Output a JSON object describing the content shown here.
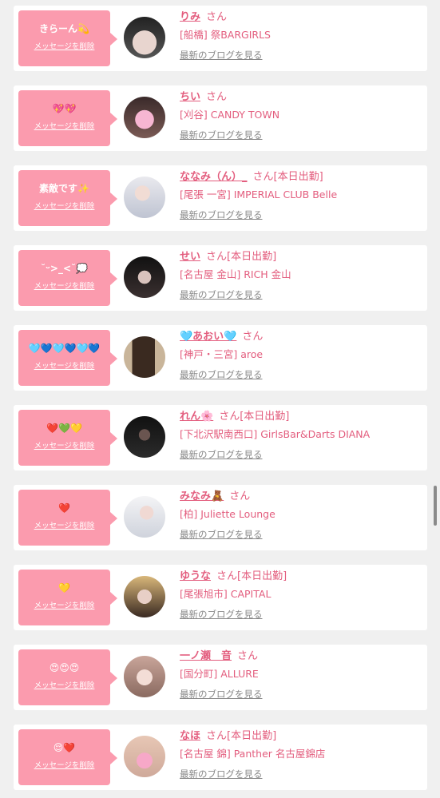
{
  "delete_label": "メッセージを削除",
  "blog_label": "最新のブログを見る",
  "honorific": "さん",
  "colors": {
    "bubble": "#fb9bae",
    "accent": "#e35d7e"
  },
  "entries": [
    {
      "message": "きらーん💫",
      "name": "りみ",
      "status": "",
      "store": "[船橋] 祭BARGIRLS",
      "avatar_icon": "cat-ears-photo"
    },
    {
      "message": "💖💖",
      "name": "ちい",
      "status": "",
      "store": "[刈谷] CANDY TOWN",
      "avatar_icon": "pink-face-photo"
    },
    {
      "message": "素敵です✨",
      "name": "ななみ（ん）_",
      "status": "[本日出勤]",
      "store": "[尾張 一宮] IMPERIAL CLUB Belle",
      "avatar_icon": "white-dress-photo"
    },
    {
      "message": "˘ᵕ>_<˘💭",
      "name": "せい",
      "status": "[本日出勤]",
      "store": "[名古屋 金山] RICH 金山",
      "avatar_icon": "dark-hair-photo"
    },
    {
      "message": "🩵💙🩵💙🩵💙",
      "name": "🩵あおい🩵",
      "status": "",
      "store": "[神戸・三宮] aroe",
      "avatar_icon": "long-hair-back-photo"
    },
    {
      "message": "❤️💚💛",
      "name": "れん🌸",
      "status": "[本日出勤]",
      "store": "[下北沢駅南西口] GirlsBar&Darts DIANA",
      "avatar_icon": "dark-room-photo"
    },
    {
      "message": "❤️",
      "name": "みなみ🧸",
      "status": "",
      "store": "[柏] Juliette Lounge",
      "avatar_icon": "light-outfit-photo"
    },
    {
      "message": "💛",
      "name": "ゆうな",
      "status": "[本日出勤]",
      "store": "[尾張旭市] CAPITAL",
      "avatar_icon": "blonde-hair-photo"
    },
    {
      "message": "😍😍😍",
      "name": "一ノ瀬　音",
      "status": "",
      "store": "[国分町] ALLURE",
      "avatar_icon": "pale-portrait-photo"
    },
    {
      "message": "😌❤️",
      "name": "なほ",
      "status": "[本日出勤]",
      "store": "[名古屋 錦] Panther 名古屋錦店",
      "avatar_icon": "pink-bow-photo"
    }
  ]
}
